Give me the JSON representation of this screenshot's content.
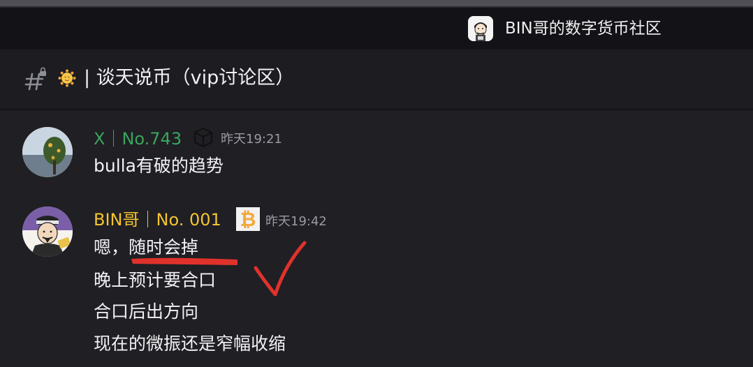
{
  "server": {
    "name": "BIN哥的数字货币社区",
    "icon": "server-avatar-icon"
  },
  "channel": {
    "icon": "locked-hash-icon",
    "emoji": "sun-emoji",
    "name": "| 谈天说币（vip讨论区）"
  },
  "messages": [
    {
      "author": "X｜No.743",
      "author_color": "#3ba55c",
      "badge_icon": "cube-icon",
      "timestamp": "昨天19:21",
      "lines": [
        "bulla有破的趋势"
      ]
    },
    {
      "author": "BIN哥｜No. 001",
      "author_color": "#f4c430",
      "badge_icon": "bitcoin-icon",
      "timestamp": "昨天19:42",
      "lines": [
        "嗯，随时会掉",
        "晚上预计要合口",
        "合口后出方向",
        "现在的微振还是窄幅收缩"
      ]
    }
  ],
  "annotations": {
    "underline_color": "#e0322b",
    "checkmark_color": "#e0322b"
  }
}
